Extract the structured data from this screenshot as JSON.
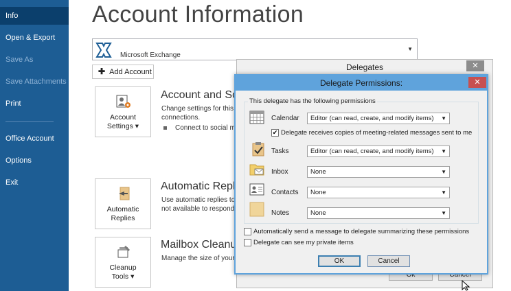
{
  "nav": {
    "items": [
      {
        "label": "Info",
        "active": true,
        "dim": false
      },
      {
        "label": "Open & Export",
        "active": false,
        "dim": false
      },
      {
        "label": "Save As",
        "active": false,
        "dim": true
      },
      {
        "label": "Save Attachments",
        "active": false,
        "dim": true
      },
      {
        "label": "Print",
        "active": false,
        "dim": false
      },
      {
        "label": "Office Account",
        "active": false,
        "dim": false
      },
      {
        "label": "Options",
        "active": false,
        "dim": false
      },
      {
        "label": "Exit",
        "active": false,
        "dim": false
      }
    ]
  },
  "main": {
    "title": "Account Information",
    "account_selector": {
      "value": "Microsoft Exchange",
      "icon": "exchange-icon"
    },
    "add_account_label": "Add Account",
    "sections": [
      {
        "tile_label_1": "Account",
        "tile_label_2": "Settings ▾",
        "icon": "account-settings-icon",
        "title": "Account and So",
        "text_1": "Change settings for this",
        "text_2": "connections.",
        "bullet": "Connect to social m"
      },
      {
        "tile_label_1": "Automatic",
        "tile_label_2": "Replies",
        "icon": "automatic-replies-icon",
        "title": "Automatic Repli",
        "text_1": "Use automatic replies to",
        "text_2": "not available to respond"
      },
      {
        "tile_label_1": "Cleanup",
        "tile_label_2": "Tools ▾",
        "icon": "cleanup-tools-icon",
        "title": "Mailbox Cleanu",
        "text_1": "Manage the size of your"
      }
    ]
  },
  "delegates_dialog": {
    "title": "Delegates",
    "close_label": "✕",
    "ok_label": "Ok",
    "cancel_label": "Cancel"
  },
  "permissions_dialog": {
    "title": "Delegate Permissions:",
    "close_label": "✕",
    "group_label": "This delegate has the following permissions",
    "rows": [
      {
        "label": "Calendar",
        "value": "Editor (can read, create, and modify items)",
        "icon": "calendar-icon"
      },
      {
        "label": "Tasks",
        "value": "Editor (can read, create, and modify items)",
        "icon": "tasks-icon"
      },
      {
        "label": "Inbox",
        "value": "None",
        "icon": "inbox-icon"
      },
      {
        "label": "Contacts",
        "value": "None",
        "icon": "contacts-icon"
      },
      {
        "label": "Notes",
        "value": "None",
        "icon": "notes-icon"
      }
    ],
    "meeting_copies": {
      "label": "Delegate receives copies of meeting-related messages sent to me",
      "checked": true
    },
    "auto_send": {
      "label": "Automatically send a message to delegate summarizing these permissions",
      "checked": false
    },
    "private_items": {
      "label": "Delegate can see my private items",
      "checked": false
    },
    "check_mark": "✔",
    "dropdown_arrow": "▼",
    "ok_label": "OK",
    "cancel_label": "Cancel"
  },
  "colors": {
    "nav_bg": "#1d5d94",
    "nav_active": "#0b3f6c",
    "dialog_accent": "#5fa3dc",
    "close_red": "#c75050"
  }
}
